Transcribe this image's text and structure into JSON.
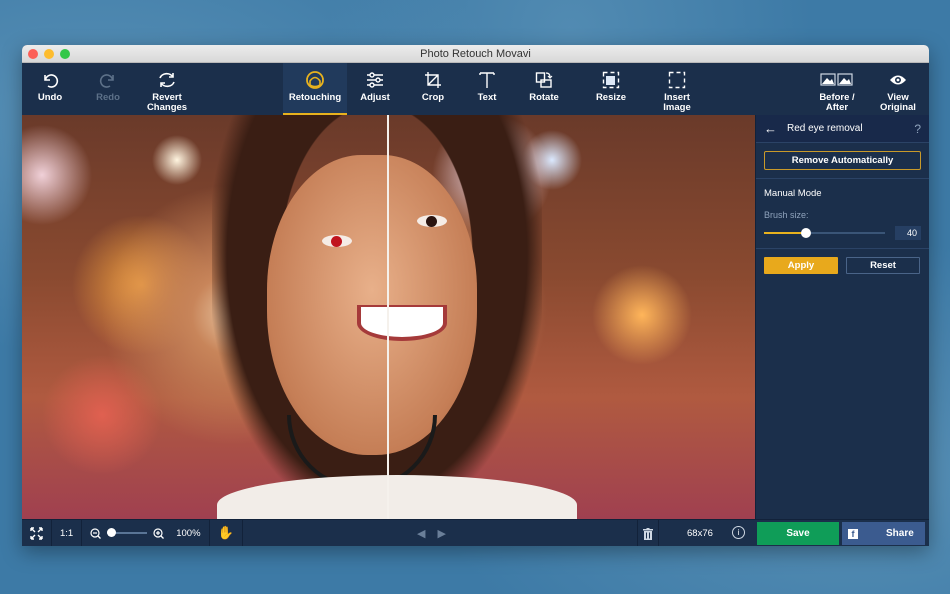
{
  "window": {
    "title": "Photo Retouch Movavi"
  },
  "toolbar": {
    "items": [
      {
        "id": "undo",
        "label": "Undo",
        "icon": "undo-icon",
        "state": "enabled"
      },
      {
        "id": "redo",
        "label": "Redo",
        "icon": "redo-icon",
        "state": "disabled"
      },
      {
        "id": "revert",
        "label": "Revert\nChanges",
        "icon": "revert-icon",
        "state": "enabled"
      },
      {
        "id": "retouching",
        "label": "Retouching",
        "icon": "retouching-icon",
        "state": "active"
      },
      {
        "id": "adjust",
        "label": "Adjust",
        "icon": "adjust-sliders-icon",
        "state": "enabled"
      },
      {
        "id": "crop",
        "label": "Crop",
        "icon": "crop-icon",
        "state": "enabled"
      },
      {
        "id": "text",
        "label": "Text",
        "icon": "text-icon",
        "state": "enabled"
      },
      {
        "id": "rotate",
        "label": "Rotate",
        "icon": "rotate-icon",
        "state": "enabled"
      },
      {
        "id": "resize",
        "label": "Resize",
        "icon": "resize-icon",
        "state": "enabled"
      },
      {
        "id": "insert",
        "label": "Insert\nImage",
        "icon": "insert-image-icon",
        "state": "enabled"
      },
      {
        "id": "before_after",
        "label": "Before /\nAfter",
        "icon": "before-after-icon",
        "state": "enabled"
      },
      {
        "id": "view_original",
        "label": "View\nOriginal",
        "icon": "eye-icon",
        "state": "enabled"
      }
    ]
  },
  "panel": {
    "title": "Red eye removal",
    "help": "?",
    "remove_auto_label": "Remove Automatically",
    "manual_mode_label": "Manual Mode",
    "brush_size_label": "Brush size:",
    "brush_size_value": "40",
    "brush_size_fraction": 0.35,
    "apply_label": "Apply",
    "reset_label": "Reset"
  },
  "bottombar": {
    "fit_icon": "fit-screen-icon",
    "actual_size_label": "1:1",
    "zoom_percent": "100%",
    "zoom_fraction": 0.1,
    "pan_icon": "hand-icon",
    "image_size": "68x76",
    "save_label": "Save",
    "share_label": "Share",
    "facebook_glyph": "f"
  },
  "colors": {
    "background": "#1b2f4b",
    "accent": "#e8b21e",
    "save": "#0f9d58",
    "share": "#3b5b8f",
    "red_eye": "#c0141e"
  }
}
